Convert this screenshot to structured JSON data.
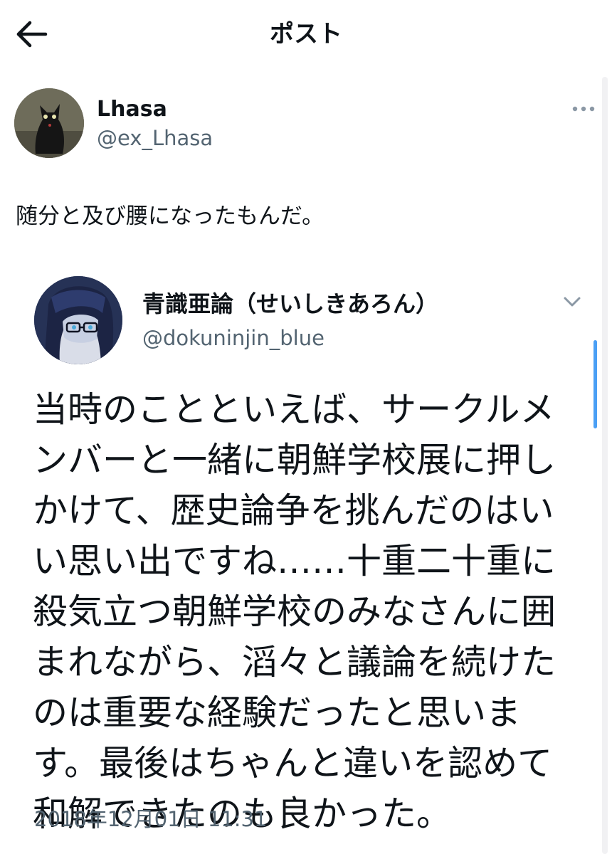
{
  "header": {
    "title": "ポスト",
    "back_icon": "arrow-left-icon"
  },
  "tweet": {
    "author": {
      "display_name": "Lhasa",
      "handle": "@ex_Lhasa"
    },
    "text": "随分と及び腰になったもんだ。",
    "more_icon": "more-horizontal-icon"
  },
  "quoted_tweet": {
    "author": {
      "display_name": "青識亜論（せいしきあろん）",
      "handle": "@dokuninjin_blue"
    },
    "expand_icon": "chevron-down-icon",
    "text": "当時のことといえば、サークルメ\nンバーと一緒に朝鮮学校展に押し\nかけて、歴史論争を挑んだのはい\nい思い出ですね……十重二十重に\n殺気立つ朝鮮学校のみなさんに囲\nまれながら、滔々と議論を続けた\nのは重要な経験だったと思いま\nす。最後はちゃんと違いを認めて\n和解できたのも良かった。",
    "timestamp": "2018年12月01日 11:31"
  },
  "colors": {
    "text_primary": "#0f1419",
    "text_secondary": "#536471",
    "scroll_accent": "#4a9ff5"
  }
}
